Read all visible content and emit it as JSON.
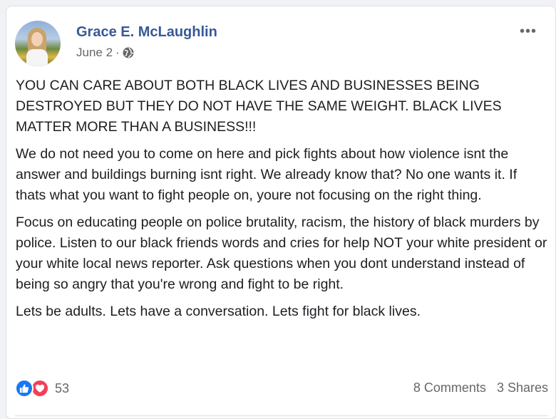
{
  "post": {
    "author": "Grace E. McLaughlin",
    "date": "June 2",
    "separator": "·",
    "privacy_icon": "globe-icon",
    "more_icon": "more-options-icon",
    "paragraphs": [
      "YOU CAN CARE ABOUT BOTH BLACK LIVES AND BUSINESSES BEING DESTROYED BUT THEY DO NOT HAVE THE SAME WEIGHT. BLACK LIVES MATTER MORE THAN A BUSINESS!!!",
      "We do not need you to come on here and pick fights about how violence isnt the answer and buildings burning isnt right. We already know that? No one wants it. If thats what you want to fight people on, youre not focusing on the right thing.",
      "Focus on educating people on police brutality, racism, the history of black murders by police. Listen to our black friends words and cries for help NOT your white president or your white local news reporter. Ask questions when you dont understand instead of being so angry that you're wrong and fight to be right.",
      "Lets be adults. Lets have a conversation. Lets fight for black lives."
    ]
  },
  "footer": {
    "reaction_icons": [
      "like-icon",
      "love-icon"
    ],
    "reaction_count": "53",
    "comments": "8 Comments",
    "shares": "3 Shares"
  },
  "colors": {
    "author_link": "#385898",
    "like": "#1877f2",
    "love": "#f33e58",
    "secondary_text": "#65676b"
  }
}
